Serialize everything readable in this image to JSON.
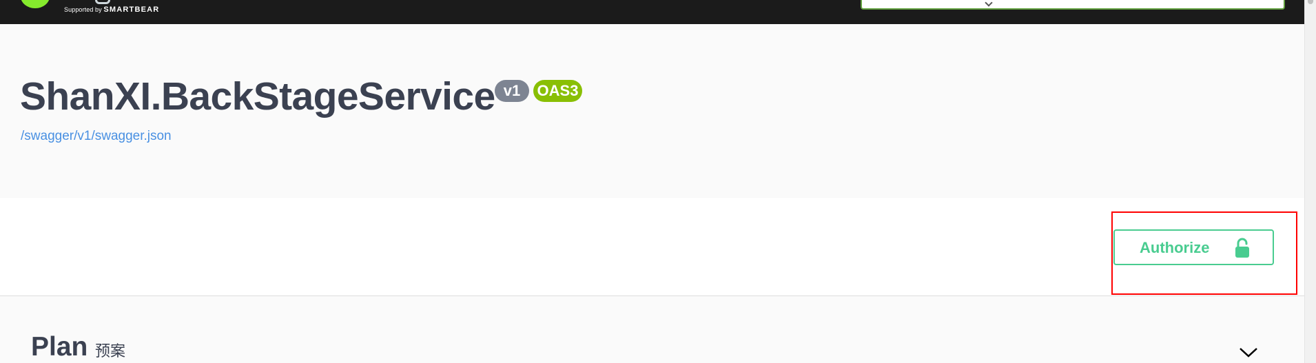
{
  "topbar": {
    "supported_by": "Supported by",
    "brand": "SMARTBEAR"
  },
  "info": {
    "title": "ShanXI.BackStageService",
    "version_badge": "v1",
    "oas_badge": "OAS3",
    "spec_link": "/swagger/v1/swagger.json"
  },
  "scheme": {
    "authorize_label": "Authorize"
  },
  "tags": [
    {
      "name": "Plan",
      "description": "预案"
    }
  ],
  "colors": {
    "topbar_bg": "#1b1b1b",
    "title": "#3b4151",
    "version_badge": "#7d8492",
    "oas_badge": "#89bf04",
    "link": "#4990e2",
    "authorize": "#49cc90",
    "highlight": "#ff0000"
  },
  "icons": {
    "authorize_icon": "unlocked-padlock-icon",
    "tag_toggle_icon": "chevron-down-icon"
  }
}
